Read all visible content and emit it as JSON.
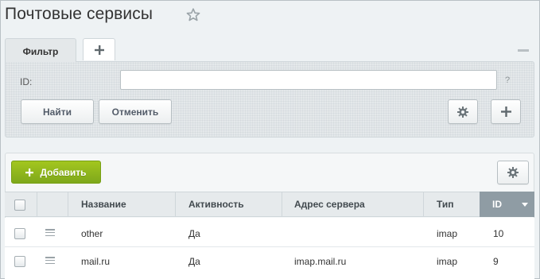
{
  "page": {
    "title": "Почтовые сервисы",
    "favorite_icon": "star-icon"
  },
  "filter": {
    "tab_label": "Фильтр",
    "add_tab_icon": "plus-icon",
    "collapse_icon": "minus-icon",
    "id_label": "ID:",
    "id_value": "",
    "id_placeholder": "",
    "help": "?",
    "find_label": "Найти",
    "cancel_label": "Отменить",
    "settings_icon": "gear-icon",
    "add_field_icon": "plus-icon"
  },
  "toolbar": {
    "add_label": "Добавить",
    "settings_icon": "gear-icon"
  },
  "table": {
    "columns": [
      "Название",
      "Активность",
      "Адрес сервера",
      "Тип",
      "ID"
    ],
    "sorted_column": "ID",
    "sort_direction": "desc",
    "rows": [
      {
        "name": "other",
        "active": "Да",
        "server": "",
        "type": "imap",
        "id": "10"
      },
      {
        "name": "mail.ru",
        "active": "Да",
        "server": "imap.mail.ru",
        "type": "imap",
        "id": "9"
      }
    ]
  },
  "colors": {
    "accent_green": "#8bb31c",
    "sorted_header": "#8f9ca4"
  }
}
